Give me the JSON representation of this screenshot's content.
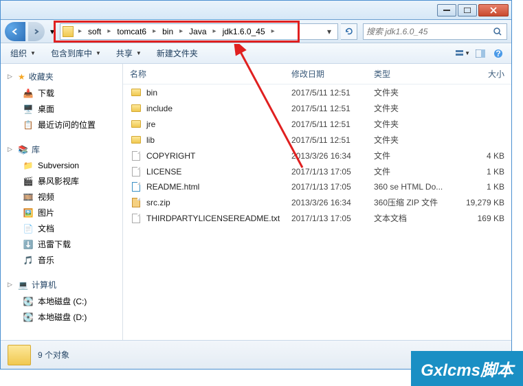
{
  "titlebar": {},
  "breadcrumbs": [
    "soft",
    "tomcat6",
    "bin",
    "Java",
    "jdk1.6.0_45"
  ],
  "search": {
    "placeholder": "搜索 jdk1.6.0_45"
  },
  "toolbar": {
    "organize": "组织",
    "include": "包含到库中",
    "share": "共享",
    "newfolder": "新建文件夹"
  },
  "sidebar": {
    "favorites": {
      "label": "收藏夹",
      "items": [
        "下载",
        "桌面",
        "最近访问的位置"
      ]
    },
    "libraries": {
      "label": "库",
      "items": [
        "Subversion",
        "暴风影视库",
        "视频",
        "图片",
        "文档",
        "迅雷下载",
        "音乐"
      ]
    },
    "computer": {
      "label": "计算机",
      "items": [
        "本地磁盘 (C:)",
        "本地磁盘 (D:)"
      ]
    }
  },
  "columns": {
    "name": "名称",
    "date": "修改日期",
    "type": "类型",
    "size": "大小"
  },
  "files": [
    {
      "icon": "folder",
      "name": "bin",
      "date": "2017/5/11 12:51",
      "type": "文件夹",
      "size": ""
    },
    {
      "icon": "folder",
      "name": "include",
      "date": "2017/5/11 12:51",
      "type": "文件夹",
      "size": ""
    },
    {
      "icon": "folder",
      "name": "jre",
      "date": "2017/5/11 12:51",
      "type": "文件夹",
      "size": ""
    },
    {
      "icon": "folder",
      "name": "lib",
      "date": "2017/5/11 12:51",
      "type": "文件夹",
      "size": ""
    },
    {
      "icon": "file",
      "name": "COPYRIGHT",
      "date": "2013/3/26 16:34",
      "type": "文件",
      "size": "4 KB"
    },
    {
      "icon": "file",
      "name": "LICENSE",
      "date": "2017/1/13 17:05",
      "type": "文件",
      "size": "1 KB"
    },
    {
      "icon": "html",
      "name": "README.html",
      "date": "2017/1/13 17:05",
      "type": "360 se HTML Do...",
      "size": "1 KB"
    },
    {
      "icon": "zip",
      "name": "src.zip",
      "date": "2013/3/26 16:34",
      "type": "360压缩 ZIP 文件",
      "size": "19,279 KB"
    },
    {
      "icon": "file",
      "name": "THIRDPARTYLICENSEREADME.txt",
      "date": "2017/1/13 17:05",
      "type": "文本文档",
      "size": "169 KB"
    }
  ],
  "status": {
    "count": "9 个对象"
  },
  "watermark": "Gxlcms脚本"
}
